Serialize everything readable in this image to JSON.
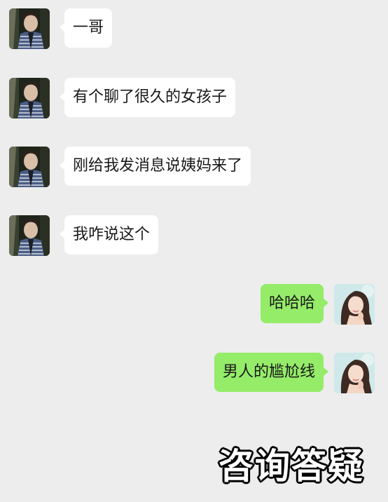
{
  "messages": [
    {
      "side": "left",
      "text": "一哥"
    },
    {
      "side": "left",
      "text": "有个聊了很久的女孩子"
    },
    {
      "side": "left",
      "text": "刚给我发消息说姨妈来了"
    },
    {
      "side": "left",
      "text": "我咋说这个"
    },
    {
      "side": "right",
      "text": "哈哈哈"
    },
    {
      "side": "right",
      "text": "男人的尴尬线"
    }
  ],
  "watermark": "咨询答疑",
  "colors": {
    "background": "#ededed",
    "left_bubble": "#ffffff",
    "right_bubble": "#95ec69",
    "text": "#191919"
  },
  "avatars": {
    "left": "user-avatar-boy",
    "right": "user-avatar-girl"
  }
}
